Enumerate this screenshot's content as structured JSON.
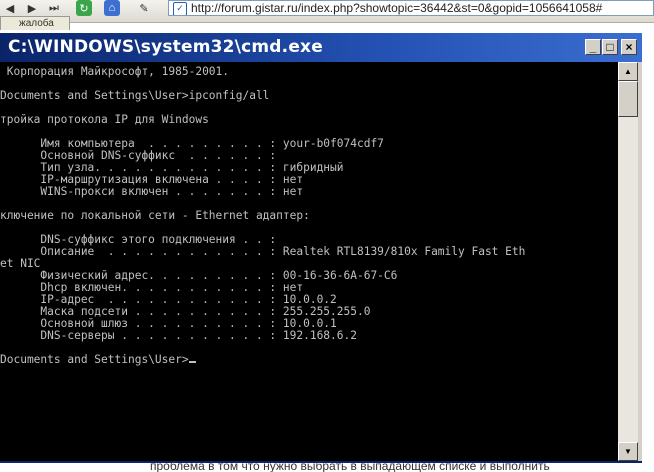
{
  "browser": {
    "tab_label": "жалоба",
    "address": "http://forum.gistar.ru/index.php?showtopic=36442&st=0&gopid=1056641058#",
    "bottom_text": "проблема в том что нужно выбрать в выпадающем списке и выполнить"
  },
  "window": {
    "title": "C:\\WINDOWS\\system32\\cmd.exe",
    "min_label": "_",
    "max_label": "□",
    "close_label": "×"
  },
  "console": {
    "lines": [
      " Корпорация Майкрософт, 1985-2001.",
      "",
      "Documents and Settings\\User>ipconfig/all",
      "",
      "тройка протокола IP для Windows",
      "",
      "      Имя компьютера  . . . . . . . . . : your-b0f074cdf7",
      "      Основной DNS-суффикс  . . . . . . :",
      "      Тип узла. . . . . . . . . . . . . : гибридный",
      "      IP-маршрутизация включена . . . . : нет",
      "      WINS-прокси включен . . . . . . . : нет",
      "",
      "ключение по локальной сети - Ethernet адаптер:",
      "",
      "      DNS-суффикс этого подключения . . :",
      "      Описание  . . . . . . . . . . . . : Realtek RTL8139/810x Family Fast Eth",
      "et NIC",
      "      Физический адрес. . . . . . . . . : 00-16-36-6A-67-C6",
      "      Dhcp включен. . . . . . . . . . . : нет",
      "      IP-адрес  . . . . . . . . . . . . : 10.0.0.2",
      "      Маска подсети . . . . . . . . . . : 255.255.255.0",
      "      Основной шлюз . . . . . . . . . . : 10.0.0.1",
      "      DNS-серверы . . . . . . . . . . . : 192.168.6.2",
      ""
    ],
    "prompt": "Documents and Settings\\User>"
  }
}
